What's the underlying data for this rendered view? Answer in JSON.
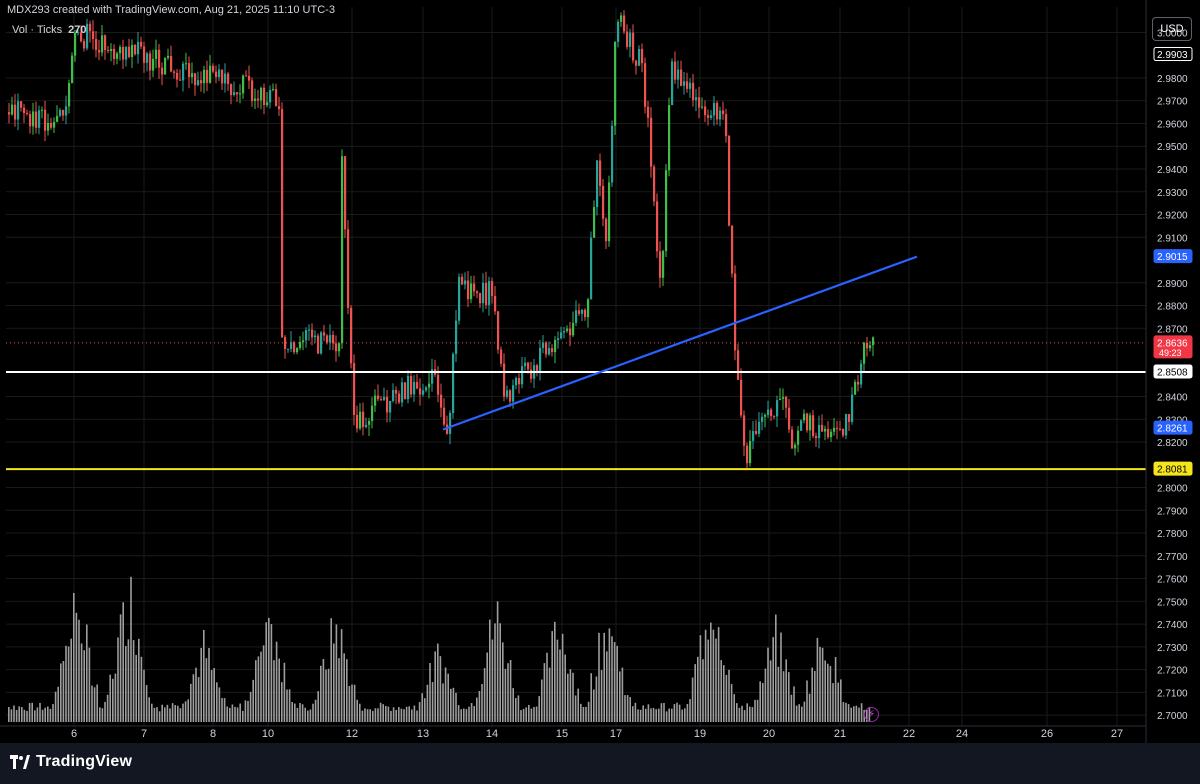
{
  "header": {
    "attribution": "MDX293 created with TradingView.com, Aug 21, 2025 11:10 UTC-3",
    "volume_label": "Vol · Ticks",
    "volume_value": "270",
    "currency": "USD"
  },
  "footer": {
    "logo_text": "TradingView",
    "logo_icon": "tradingview-logo-icon"
  },
  "replay_icon": "lightning-icon",
  "colors": {
    "background": "#000000",
    "up_candle": "#26a69a",
    "up_candle_bright": "#3fbf4a",
    "down_candle": "#ef5350",
    "trendline": "#2962ff",
    "support_white": "#ffffff",
    "support_yellow": "#f5e51c",
    "volume": "#9e9e9e",
    "grid": "#1a1a1a"
  },
  "chart_data": {
    "type": "candlestick",
    "price_range": [
      2.6952,
      3.0112
    ],
    "y_ticks": [
      "3.0000",
      "2.9800",
      "2.9700",
      "2.9600",
      "2.9500",
      "2.9400",
      "2.9300",
      "2.9200",
      "2.9100",
      "2.8900",
      "2.8800",
      "2.8700",
      "2.8400",
      "2.8300",
      "2.8200",
      "2.8000",
      "2.7900",
      "2.7800",
      "2.7700",
      "2.7600",
      "2.7500",
      "2.7400",
      "2.7300",
      "2.7200",
      "2.7100",
      "2.7000"
    ],
    "x_ticks": [
      "6",
      "7",
      "8",
      "10",
      "12",
      "13",
      "14",
      "15",
      "17",
      "19",
      "20",
      "21",
      "22",
      "24",
      "26",
      "27"
    ],
    "grid": true,
    "horizontal_lines": [
      {
        "price": 2.8508,
        "label": "2.8508",
        "color": "#ffffff"
      },
      {
        "price": 2.8081,
        "label": "2.8081",
        "color": "#f5e51c"
      }
    ],
    "trendline": {
      "from": {
        "date": "13",
        "price": 2.8255
      },
      "to": {
        "date": "22",
        "price": 2.9015
      }
    },
    "price_labels": [
      {
        "price": 2.9903,
        "text": "2.9903",
        "kind": "outline"
      },
      {
        "price": 2.9015,
        "text": "2.9015",
        "kind": "blue"
      },
      {
        "price": 2.8636,
        "text": "2.8636",
        "sub": "49:23",
        "kind": "red"
      },
      {
        "price": 2.8508,
        "text": "2.8508",
        "kind": "outline"
      },
      {
        "price": 2.8261,
        "text": "2.8261",
        "kind": "blue"
      },
      {
        "price": 2.8081,
        "text": "2.8081",
        "kind": "yellow"
      }
    ],
    "last_price": 2.8636,
    "key_levels": [
      {
        "date": "6",
        "price": 2.96
      },
      {
        "date": "6",
        "price": 3.0
      },
      {
        "date": "10",
        "price": 2.97
      },
      {
        "date": "11",
        "price": 3.01
      },
      {
        "date": "12",
        "price": 2.95
      },
      {
        "date": "12",
        "price": 2.83
      },
      {
        "date": "13",
        "price": 2.85
      },
      {
        "date": "13",
        "price": 2.8255
      },
      {
        "date": "13",
        "price": 2.89
      },
      {
        "date": "14",
        "price": 2.885
      },
      {
        "date": "14",
        "price": 2.839
      },
      {
        "date": "15",
        "price": 2.88
      },
      {
        "date": "15",
        "price": 2.94
      },
      {
        "date": "15",
        "price": 2.91
      },
      {
        "date": "15",
        "price": 3.01
      },
      {
        "date": "17",
        "price": 2.985
      },
      {
        "date": "17",
        "price": 2.945
      },
      {
        "date": "17",
        "price": 2.885
      },
      {
        "date": "17",
        "price": 2.985
      },
      {
        "date": "19",
        "price": 2.96
      },
      {
        "date": "19",
        "price": 2.86
      },
      {
        "date": "19",
        "price": 2.815
      },
      {
        "date": "20",
        "price": 2.84
      },
      {
        "date": "20",
        "price": 2.815
      },
      {
        "date": "20",
        "price": 2.83
      },
      {
        "date": "21",
        "price": 2.82
      },
      {
        "date": "21",
        "price": 2.84
      },
      {
        "date": "21",
        "price": 2.8636
      }
    ],
    "volume_peaks": [
      {
        "date": "6",
        "level": 0.7
      },
      {
        "date": "6",
        "level": 0.85
      },
      {
        "date": "7",
        "level": 0.95
      },
      {
        "date": "8",
        "level": 0.55
      },
      {
        "date": "10",
        "level": 0.6
      },
      {
        "date": "10",
        "level": 0.8
      },
      {
        "date": "12",
        "level": 0.72
      },
      {
        "date": "13",
        "level": 0.5
      },
      {
        "date": "14",
        "level": 0.8
      },
      {
        "date": "15",
        "level": 0.72
      },
      {
        "date": "17",
        "level": 0.75
      },
      {
        "date": "19",
        "level": 0.94
      },
      {
        "date": "20",
        "level": 0.62
      },
      {
        "date": "21",
        "level": 0.65
      }
    ]
  }
}
